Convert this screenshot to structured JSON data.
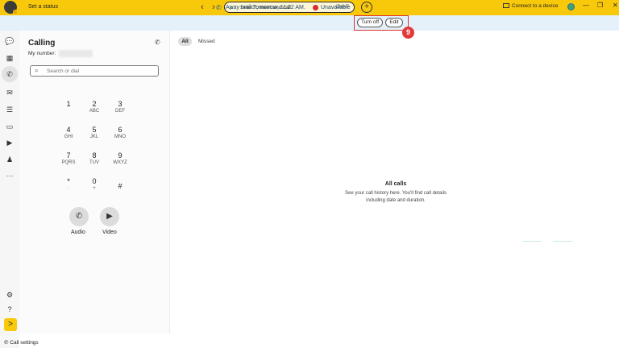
{
  "topbar": {
    "set_status": "Set a status",
    "search_placeholder": "Search, meet and call",
    "search_shortcut": "Ctrl+F",
    "connect_device": "Connect to a device",
    "icons": {
      "back": "chevron-left-icon",
      "forward": "chevron-right-icon",
      "search": "search-icon",
      "add": "plus-icon",
      "minimize": "minimize-icon",
      "restore": "restore-icon",
      "close": "close-icon"
    }
  },
  "banner": {
    "away_text": "Away until Tomorrow, 11:22 AM.",
    "unavailable_text": "Unavailable",
    "turn_off_label": "Turn off",
    "edit_label": "Edit",
    "marker_number": "9",
    "status_color": "#d72d2d"
  },
  "calling": {
    "title": "Calling",
    "my_number_label": "My number:",
    "search_placeholder": "Search or dial",
    "keys": [
      {
        "num": "1",
        "sub": ""
      },
      {
        "num": "2",
        "sub": "ABC"
      },
      {
        "num": "3",
        "sub": "DEF"
      },
      {
        "num": "4",
        "sub": "GHI"
      },
      {
        "num": "5",
        "sub": "JKL"
      },
      {
        "num": "6",
        "sub": "MNO"
      },
      {
        "num": "7",
        "sub": "PQRS"
      },
      {
        "num": "8",
        "sub": "TUV"
      },
      {
        "num": "9",
        "sub": "WXYZ"
      },
      {
        "num": "*",
        "sub": "·"
      },
      {
        "num": "0",
        "sub": "+"
      },
      {
        "num": "#",
        "sub": ""
      }
    ],
    "audio_label": "Audio",
    "video_label": "Video"
  },
  "main": {
    "tabs": [
      {
        "label": "All",
        "active": true
      },
      {
        "label": "Missed",
        "active": false
      }
    ],
    "empty_title": "All calls",
    "empty_description": "See your call history here. You'll find call details including date and duration."
  },
  "footer": {
    "call_settings": "Call settings"
  },
  "colors": {
    "accent": "#f8c80a",
    "banner_bg": "#e4f1fb",
    "highlight": "#e03030"
  }
}
